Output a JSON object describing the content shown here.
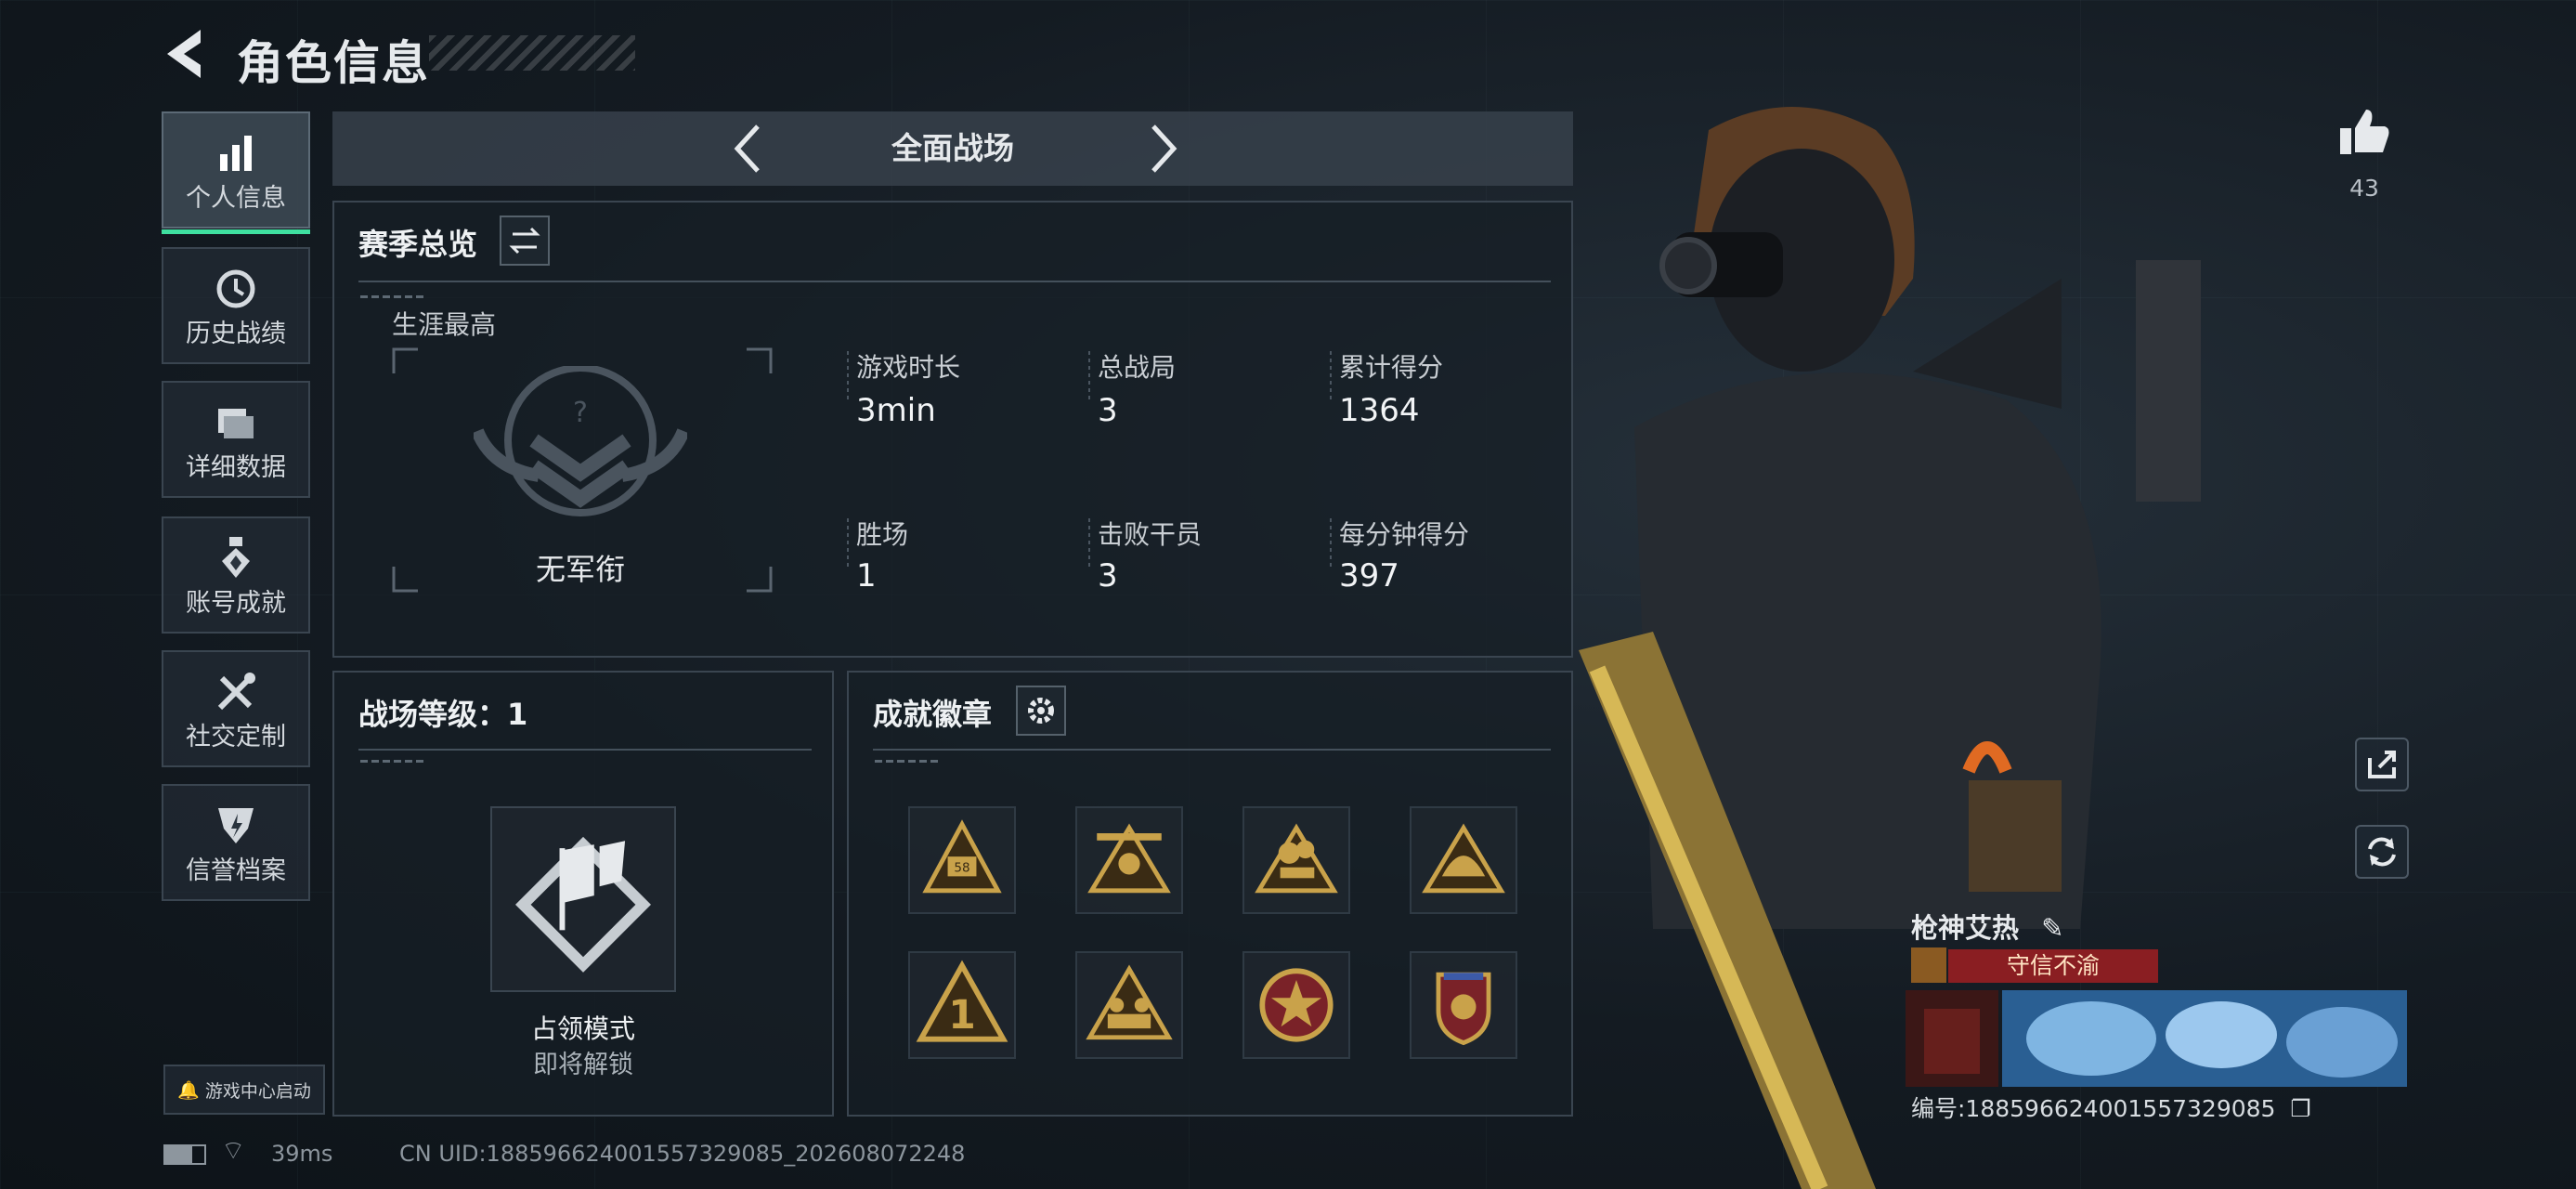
{
  "header": {
    "title": "角色信息"
  },
  "sidebar": {
    "items": [
      {
        "label": "个人信息",
        "icon": "bar-chart-icon",
        "active": true
      },
      {
        "label": "历史战绩",
        "icon": "history-clock-icon",
        "active": false
      },
      {
        "label": "详细数据",
        "icon": "folder-icon",
        "active": false
      },
      {
        "label": "账号成就",
        "icon": "achievement-medal-icon",
        "active": false
      },
      {
        "label": "社交定制",
        "icon": "tools-icon",
        "active": false
      },
      {
        "label": "信誉档案",
        "icon": "credit-badge-icon",
        "active": false
      }
    ],
    "game_center": "游戏中心启动"
  },
  "mode": {
    "label": "全面战场"
  },
  "season": {
    "title": "赛季总览",
    "career_label": "生涯最高",
    "rank_label": "无军衔",
    "stats": [
      {
        "label": "游戏时长",
        "value": "3min"
      },
      {
        "label": "总战局",
        "value": "3"
      },
      {
        "label": "累计得分",
        "value": "1364"
      },
      {
        "label": "胜场",
        "value": "1"
      },
      {
        "label": "击败干员",
        "value": "3"
      },
      {
        "label": "每分钟得分",
        "value": "397"
      }
    ]
  },
  "battlefield_level": {
    "title": "战场等级：1",
    "mode_name": "占领模式",
    "mode_status": "即将解锁"
  },
  "badges": {
    "title": "成就徽章",
    "items": [
      "badge-58",
      "badge-59",
      "badge-57",
      "badge-helmet",
      "badge-1",
      "badge-squad",
      "badge-star-wreath",
      "badge-shield-wings"
    ]
  },
  "profile": {
    "like_count": "43",
    "player_name": "枪神艾热",
    "motto": "守信不渝",
    "uid": "编号:1885966240015573290​85"
  },
  "footer": {
    "ping": "39ms",
    "cn_uid": "CN UID:1885966240015573290​85_202608072248"
  },
  "colors": {
    "accent": "#3fe0a0",
    "motto_bg": "#8a1e22",
    "gold": "#c9a24a"
  }
}
